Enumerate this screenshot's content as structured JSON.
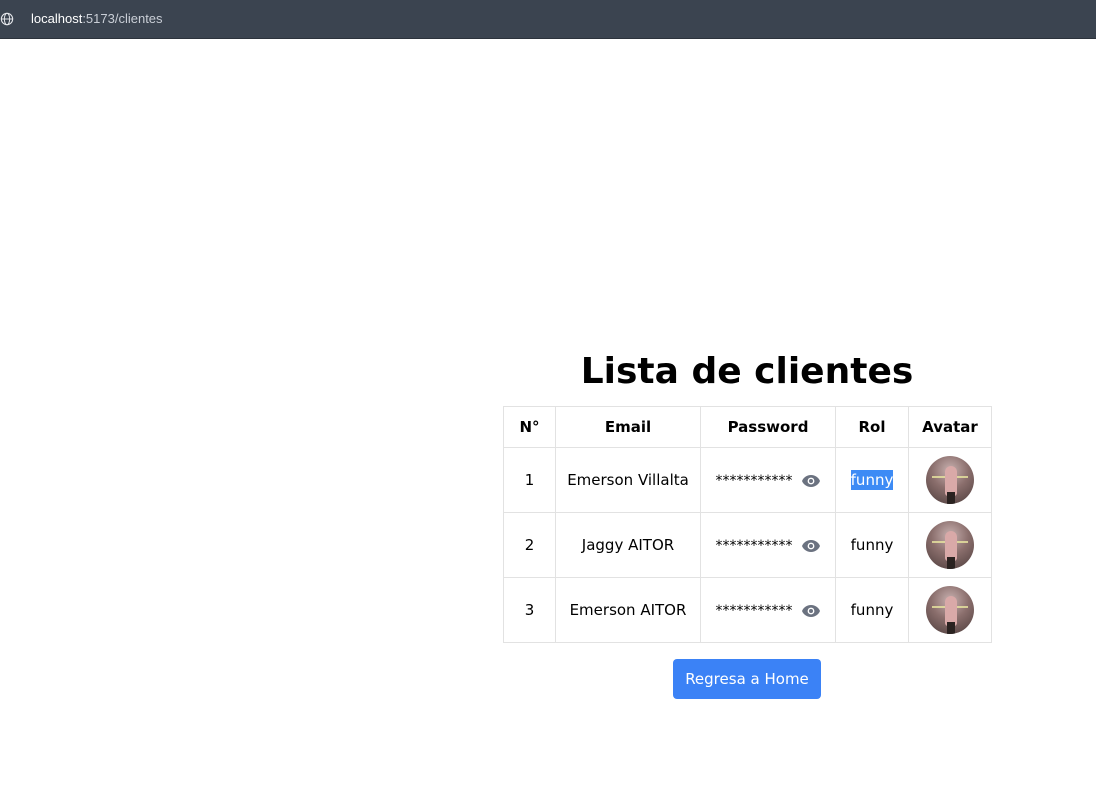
{
  "browser": {
    "url_host": "localhost",
    "url_path": ":5173/clientes"
  },
  "page": {
    "title": "Lista de clientes",
    "home_button": "Regresa a Home"
  },
  "table": {
    "headers": [
      "N°",
      "Email",
      "Password",
      "Rol",
      "Avatar"
    ],
    "rows": [
      {
        "num": "1",
        "email": "Emerson Villalta",
        "password": "***********",
        "rol": "funny",
        "rol_selected": true
      },
      {
        "num": "2",
        "email": "Jaggy AITOR",
        "password": "***********",
        "rol": "funny",
        "rol_selected": false
      },
      {
        "num": "3",
        "email": "Emerson AITOR",
        "password": "***********",
        "rol": "funny",
        "rol_selected": false
      }
    ]
  },
  "icons": {
    "show_password": "eye-icon",
    "site": "globe-icon"
  },
  "colors": {
    "topbar": "#3b4450",
    "button": "#3b82f6",
    "selection": "#3d8bf5",
    "eye": "#6b7280"
  }
}
